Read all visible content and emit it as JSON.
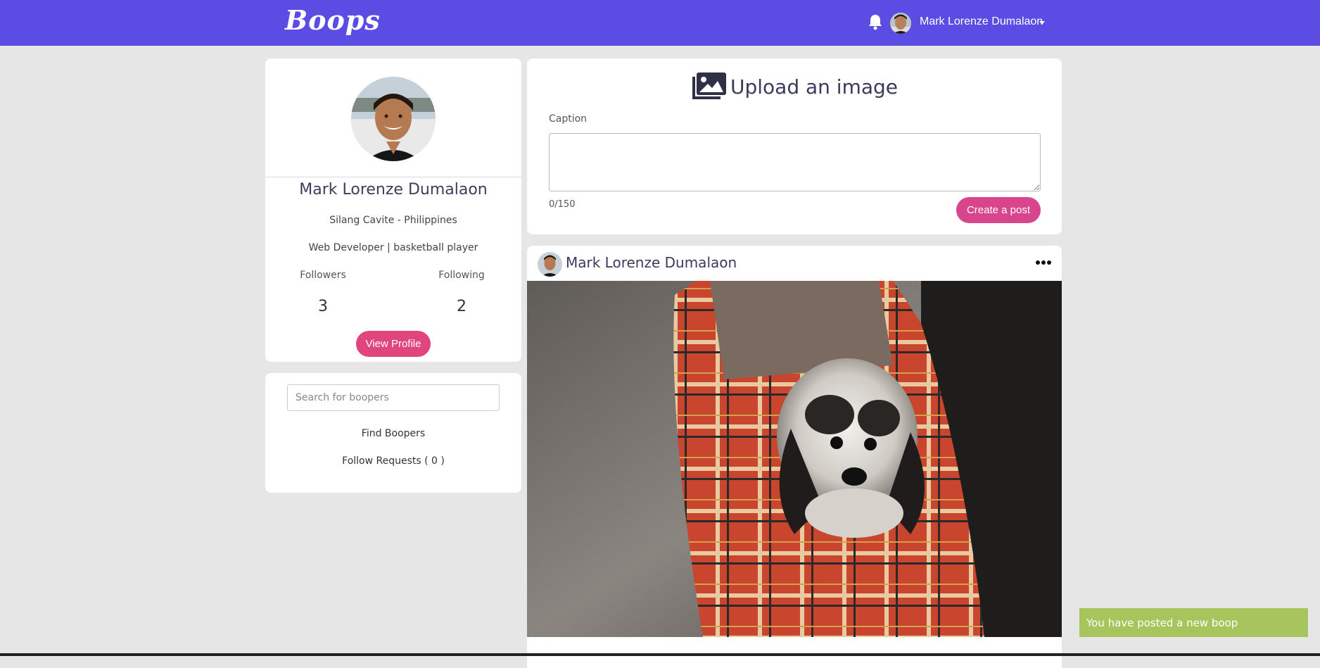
{
  "colors": {
    "navbar": "#5b4de3",
    "page_bg": "#e6e6e6",
    "view_profile_button": "#e0457b",
    "create_post_button": "#d9458d",
    "toast_bg": "#a8c45c"
  },
  "navbar": {
    "brand": "Boops",
    "user_name": "Mark Lorenze Dumalaon",
    "icons": [
      "bell-icon",
      "caret-down-icon"
    ]
  },
  "profile": {
    "name": "Mark Lorenze Dumalaon",
    "location": "Silang Cavite - Philippines",
    "bio": "Web Developer | basketball player",
    "followers_label": "Followers",
    "followers_count": "3",
    "following_label": "Following",
    "following_count": "2",
    "view_profile_label": "View Profile"
  },
  "search": {
    "placeholder": "Search for boopers",
    "find_label": "Find Boopers",
    "requests_label": "Follow Requests ( 0 )"
  },
  "upload": {
    "title": "Upload an image",
    "icon": "images-icon",
    "caption_label": "Caption",
    "char_count": "0/150",
    "submit_label": "Create a post"
  },
  "post": {
    "author": "Mark Lorenze Dumalaon",
    "menu_icon": "ellipsis-icon"
  },
  "toast": {
    "message": "You have posted a new boop"
  }
}
